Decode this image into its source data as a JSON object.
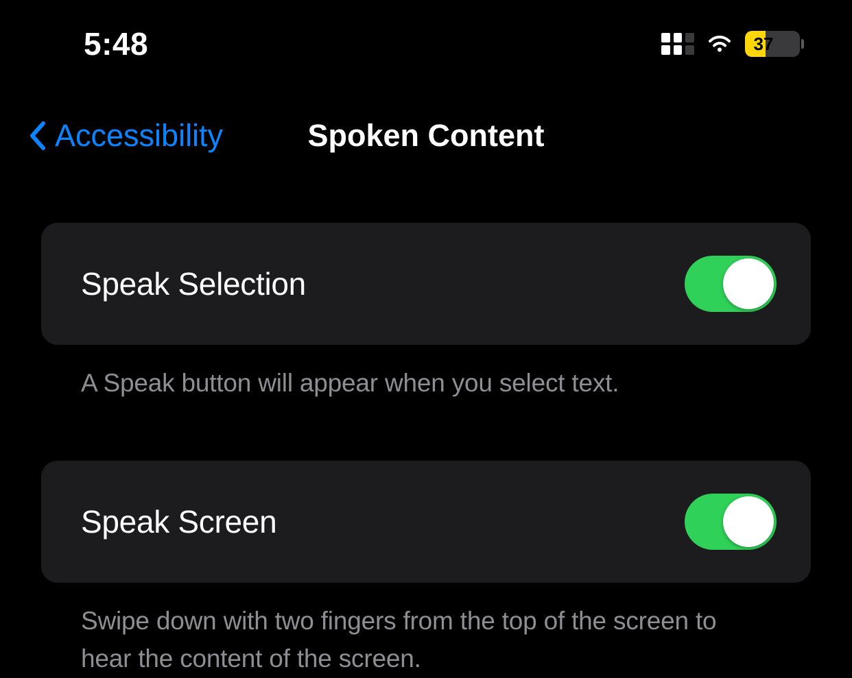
{
  "status": {
    "time": "5:48",
    "battery_percent": "37"
  },
  "nav": {
    "back_label": "Accessibility",
    "title": "Spoken Content"
  },
  "settings": {
    "speak_selection": {
      "label": "Speak Selection",
      "on": true,
      "description": "A Speak button will appear when you select text."
    },
    "speak_screen": {
      "label": "Speak Screen",
      "on": true,
      "description": "Swipe down with two fingers from the top of the screen to hear the content of the screen."
    }
  }
}
